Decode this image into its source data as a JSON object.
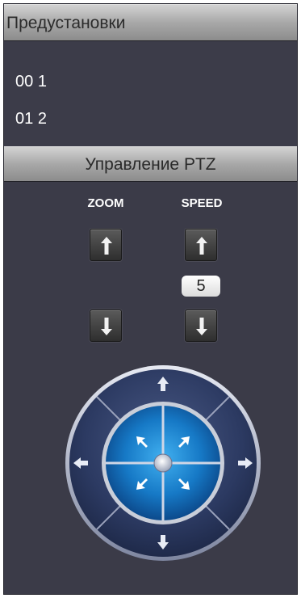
{
  "presets": {
    "header": "Предустановки",
    "items": [
      {
        "num": "00",
        "name": "1"
      },
      {
        "num": "01",
        "name": "2"
      }
    ]
  },
  "ptz": {
    "header": "Управление PTZ",
    "zoom_label": "ZOOM",
    "speed_label": "SPEED",
    "speed_value": "5"
  },
  "icons": {
    "up": "arrow-up-icon",
    "down": "arrow-down-icon",
    "left": "arrow-left-icon",
    "right": "arrow-right-icon",
    "diag_up_left": "arrow-up-left-icon",
    "diag_up_right": "arrow-up-right-icon",
    "diag_down_left": "arrow-down-left-icon",
    "diag_down_right": "arrow-down-right-icon"
  },
  "colors": {
    "panel_bg": "#3b3b48",
    "header_gradient_top": "#d2d2d2",
    "header_gradient_bottom": "#8c8c8c",
    "wheel_center_blue": "#1e8fd6",
    "wheel_ring": "#2b3a63"
  }
}
